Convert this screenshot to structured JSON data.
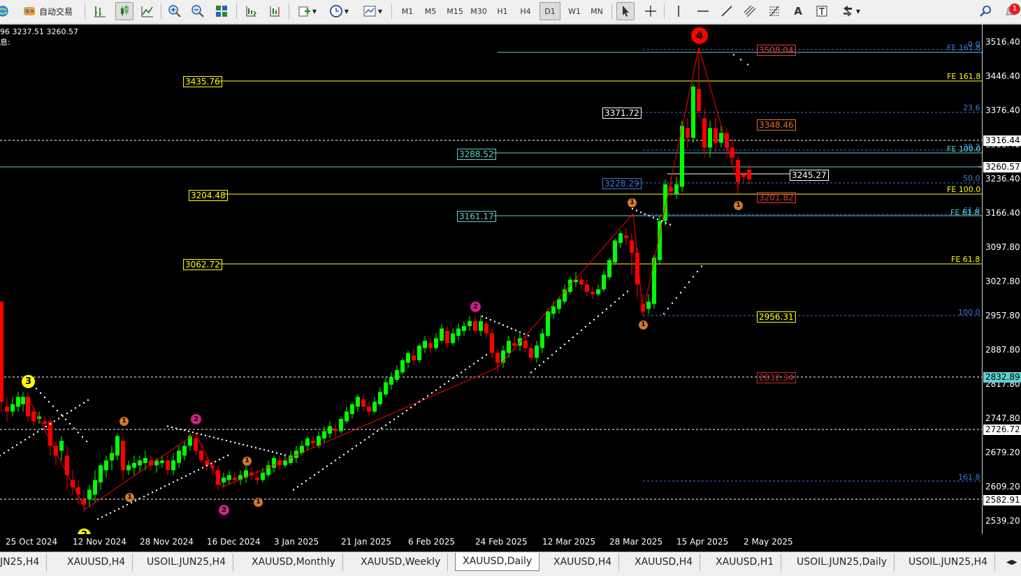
{
  "toolbar": {
    "autotrade_label": "自动交易",
    "timeframes": [
      "M1",
      "M5",
      "M15",
      "M30",
      "H1",
      "H4",
      "D1",
      "W1",
      "MN"
    ],
    "active_timeframe": "D1",
    "notification_count": "1"
  },
  "chart": {
    "info_line": "96 3237.51 3260.57",
    "info_line2": "息:",
    "background": "#000000",
    "bull_color": "#00ff00",
    "bear_color": "#ff0000",
    "hline_color": "#ffff00",
    "fib_color": "#3d7bd6",
    "wave_color": "#ff0000"
  },
  "price_scale": {
    "labels": [
      "3516.40",
      "3446.40",
      "3376.40",
      "3306.40",
      "3236.40",
      "3166.40",
      "3097.80",
      "3027.80",
      "2957.80",
      "2887.80",
      "2817.80",
      "2747.80",
      "2679.20",
      "2609.20",
      "2539.20"
    ],
    "tags": [
      {
        "text": "3316.44",
        "bg": "#ffffff",
        "fg": "#000000"
      },
      {
        "text": "3260.57",
        "bg": "#ffffff",
        "fg": "#000000"
      },
      {
        "text": "2832.89",
        "bg": "#5fcfcf",
        "fg": "#000000"
      },
      {
        "text": "2726.72",
        "bg": "#ffffff",
        "fg": "#000000"
      },
      {
        "text": "2582.91",
        "bg": "#ffffff",
        "fg": "#000000"
      }
    ]
  },
  "levels": [
    {
      "text": "3435.76",
      "color": "#ffff00",
      "bg": "#000000"
    },
    {
      "text": "3371.72",
      "color": "#ffffff",
      "bg": "#000000"
    },
    {
      "text": "3288.52",
      "color": "#5fd0c8",
      "bg": "#000000"
    },
    {
      "text": "3228.29",
      "color": "#3d7bd6",
      "bg": "#000000"
    },
    {
      "text": "3204.48",
      "color": "#ffff00",
      "bg": "#000000"
    },
    {
      "text": "3161.17",
      "color": "#5fd0c8",
      "bg": "#000000"
    },
    {
      "text": "3062.72",
      "color": "#ffff00",
      "bg": "#000000"
    },
    {
      "text": "3245.27",
      "color": "#ffffff",
      "bg": "#000000"
    },
    {
      "text": "3348.46",
      "color": "#e0702a",
      "bg": "#000000"
    },
    {
      "text": "3201.82",
      "color": "#e03a3a",
      "bg": "#000000"
    },
    {
      "text": "2956.31",
      "color": "#ffff00",
      "bg": "#000000"
    },
    {
      "text": "2832.34",
      "color": "#c03030",
      "bg": "#000000"
    },
    {
      "text": "3508.04",
      "color": "#e03a3a",
      "bg": "#000000"
    }
  ],
  "fib_labels": [
    "0.0",
    "FE 161.8",
    "FE 161.8",
    "23.6",
    "38.2",
    "FE 100.0",
    "50.0",
    "FE 100.0",
    "61.8",
    "FE 61.8",
    "FE 61.8",
    "100.0",
    "161.8"
  ],
  "wave_labels": [
    "3",
    "4",
    "2",
    "2",
    "2",
    "2",
    "1",
    "1",
    "1",
    "1",
    "1",
    "1",
    "1"
  ],
  "time_axis": [
    "25 Oct 2024",
    "12 Nov 2024",
    "28 Nov 2024",
    "16 Dec 2024",
    "3 Jan 2025",
    "21 Jan 2025",
    "6 Feb 2025",
    "24 Feb 2025",
    "12 Mar 2025",
    "28 Mar 2025",
    "15 Apr 2025",
    "2 May 2025"
  ],
  "tabs": [
    "JN25,H4",
    "XAUUSD,H4",
    "USOIL.JUN25,H4",
    "XAUUSD,Monthly",
    "XAUUSD,Weekly",
    "XAUUSD,Daily",
    "XAUUSD,H4",
    "XAUUSD,H4",
    "XAUUSD,H1",
    "USOIL.JUN25,Daily",
    "USOIL.JUN25,H4"
  ],
  "active_tab": "XAUUSD,Daily"
}
